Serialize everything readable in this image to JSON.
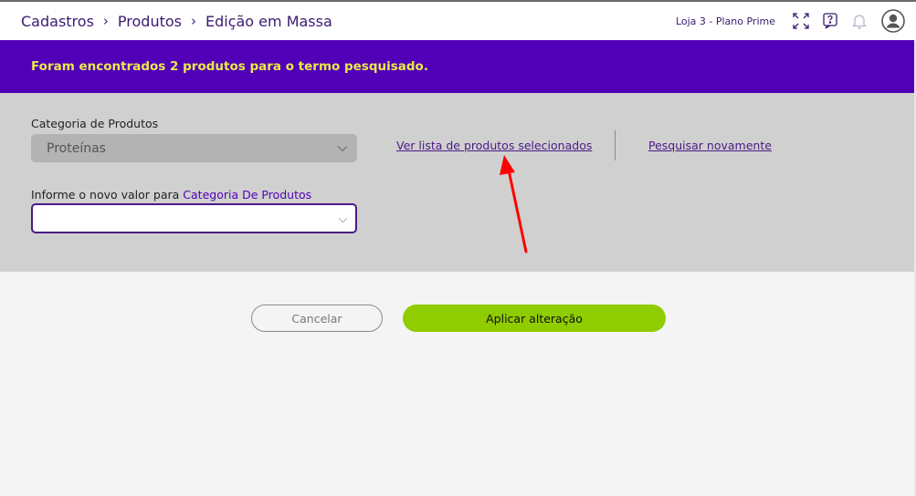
{
  "breadcrumb": [
    "Cadastros",
    "Produtos",
    "Edição em Massa"
  ],
  "header": {
    "store": "Loja 3 - Plano Prime",
    "icons": [
      "expand-icon",
      "help-icon",
      "bell-icon",
      "user-avatar-icon"
    ]
  },
  "banner": {
    "message": "Foram encontrados 2 produtos para o termo pesquisado."
  },
  "form": {
    "category_label": "Categoria de Produtos",
    "category_value": "Proteínas",
    "new_value_label_prefix": "Informe o novo valor para",
    "new_value_label_field": "Categoria De Produtos",
    "new_value_value": ""
  },
  "links": {
    "view_selected": "Ver lista de produtos selecionados",
    "search_again": "Pesquisar novamente"
  },
  "buttons": {
    "cancel": "Cancelar",
    "apply": "Aplicar alteração"
  },
  "colors": {
    "brand_purple": "#5200b8",
    "banner_text": "#e8ea4a",
    "apply_green": "#8fcc00",
    "annotation_arrow": "#ff0000"
  }
}
